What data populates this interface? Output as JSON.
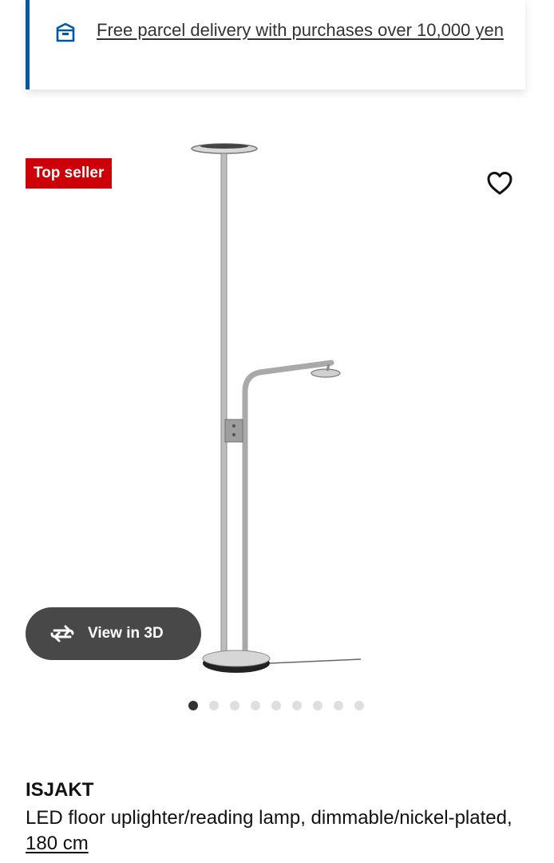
{
  "banner": {
    "icon": "delivery-box-icon",
    "text": "Free parcel delivery with purchases over 10,000 yen",
    "accent_color": "#0058a3"
  },
  "product": {
    "badge": "Top seller",
    "badge_color": "#cc0008",
    "favorite_icon": "heart-outline-icon",
    "view_3d_label": "View in 3D",
    "view_3d_icon": "rotate-arrows-icon",
    "carousel": {
      "total": 9,
      "active_index": 0
    },
    "name": "ISJAKT",
    "description": "LED floor uplighter/reading lamp, dimmable/nickel-plated, ",
    "size": "180 cm"
  }
}
